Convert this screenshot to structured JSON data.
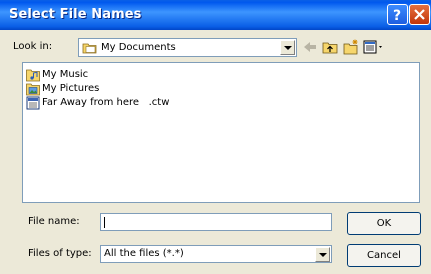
{
  "window": {
    "title": "Select File Names"
  },
  "look_in": {
    "label": "Look in:",
    "value": "My Documents",
    "icon": "folder-icon"
  },
  "toolbar": {
    "icons": [
      "back-arrow-icon",
      "up-folder-icon",
      "new-folder-icon",
      "view-menu-icon"
    ]
  },
  "files": [
    {
      "name": "My Music",
      "icon": "folder-music-icon"
    },
    {
      "name": "My Pictures",
      "icon": "folder-pictures-icon"
    },
    {
      "name": "Far Away from here   .ctw",
      "icon": "ctw-file-icon"
    }
  ],
  "file_name": {
    "label": "File name:",
    "value": ""
  },
  "file_type": {
    "label": "Files of type:",
    "value": "All the files (*.*)"
  },
  "buttons": {
    "ok": "OK",
    "cancel": "Cancel"
  }
}
